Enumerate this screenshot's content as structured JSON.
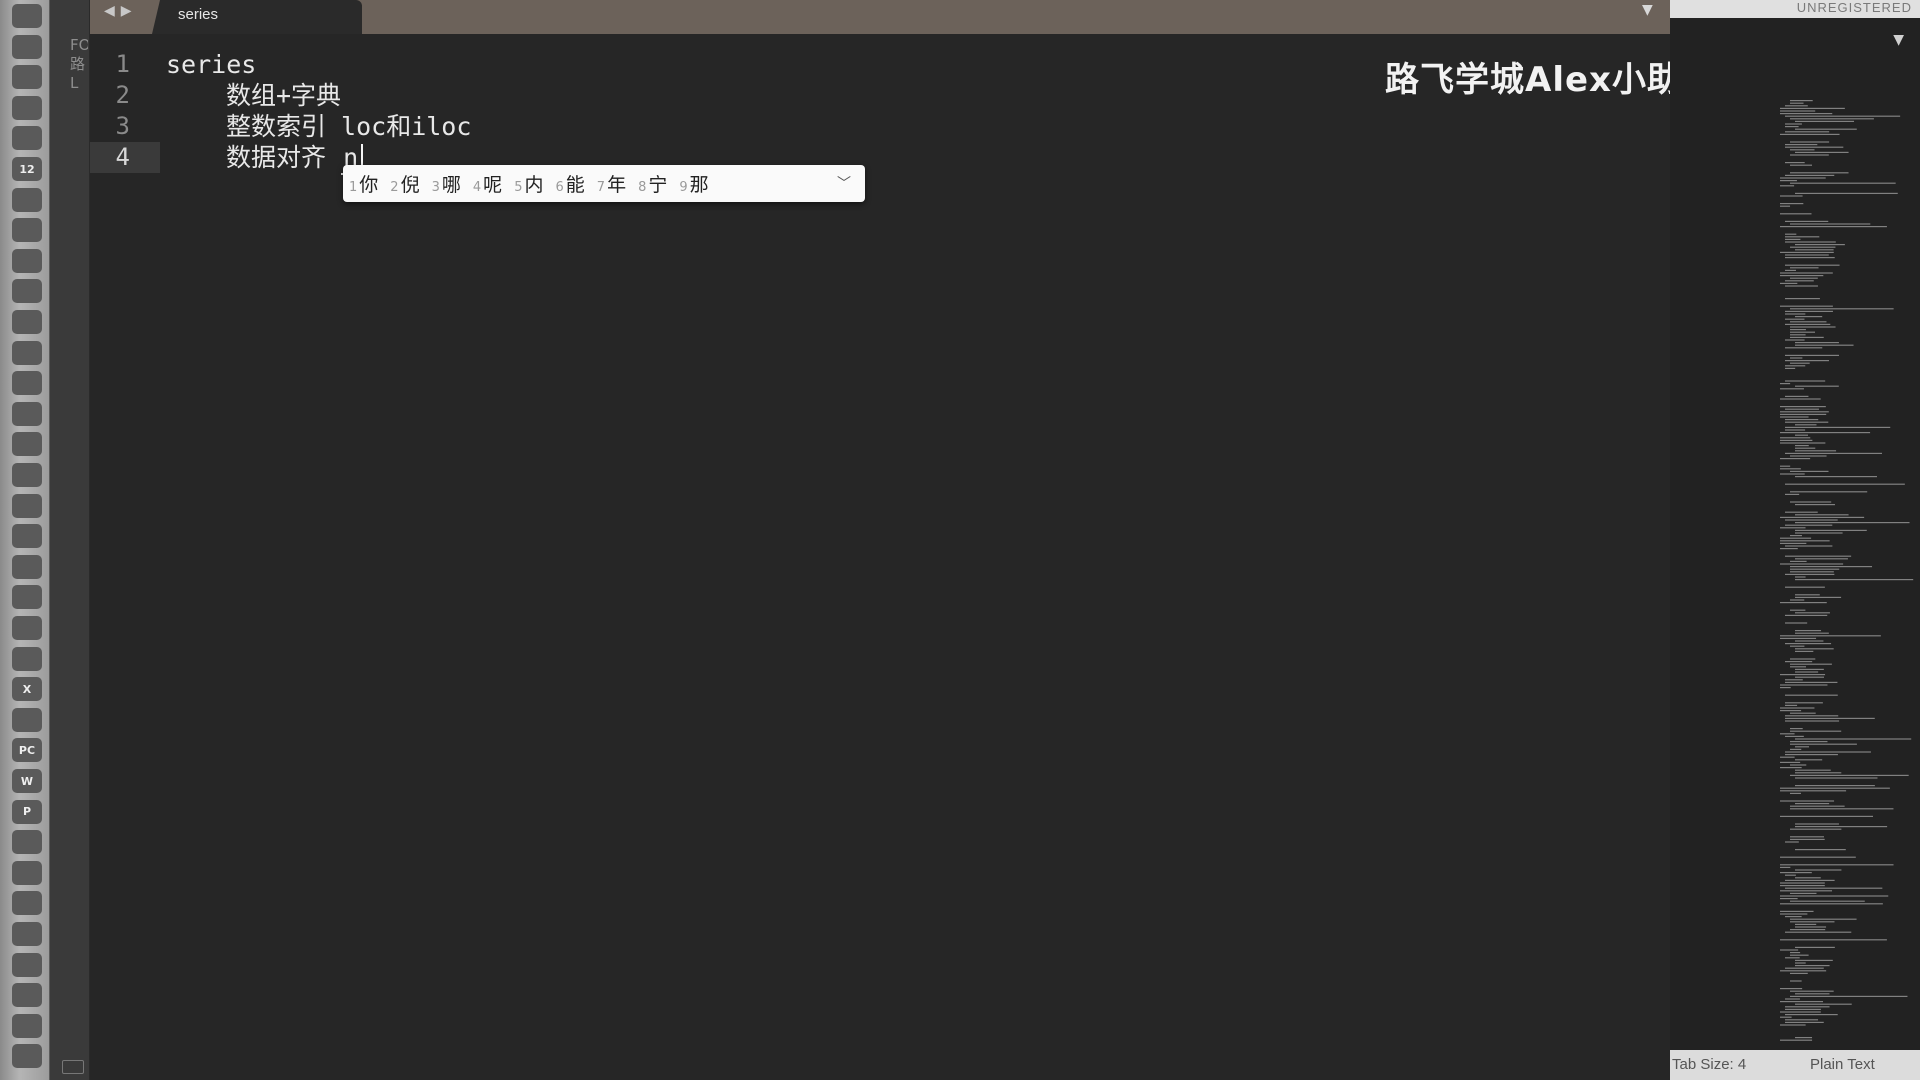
{
  "tab": {
    "title": "series"
  },
  "sidebar": {
    "label": "FO 路 L"
  },
  "editor": {
    "line_numbers": [
      "1",
      "2",
      "3",
      "4"
    ],
    "lines": [
      "series",
      "数组+字典",
      "整数索引 loc和iloc",
      "数据对齐 "
    ],
    "composing_text": "n"
  },
  "ime": {
    "candidates": [
      {
        "num": "1",
        "char": "你"
      },
      {
        "num": "2",
        "char": "倪"
      },
      {
        "num": "3",
        "char": "哪"
      },
      {
        "num": "4",
        "char": "呢"
      },
      {
        "num": "5",
        "char": "内"
      },
      {
        "num": "6",
        "char": "能"
      },
      {
        "num": "7",
        "char": "年"
      },
      {
        "num": "8",
        "char": "宁"
      },
      {
        "num": "9",
        "char": "那"
      }
    ],
    "expand_icon": "chevron-down-icon"
  },
  "watermark": {
    "text": "路飞学城Alex小助理",
    "logo": "bilibili"
  },
  "minimap": {
    "unregistered": "UNREGISTERED"
  },
  "status": {
    "tab_size": "Tab Size: 4",
    "syntax": "Plain Text"
  },
  "dock": {
    "items": [
      "",
      "",
      "",
      "",
      "",
      "12",
      "",
      "",
      "",
      "",
      "",
      "",
      "",
      "",
      "",
      "",
      "",
      "",
      "",
      "",
      "",
      "",
      "X",
      "",
      "PC",
      "W",
      "P",
      "",
      "",
      "",
      "",
      "",
      "",
      "",
      ""
    ]
  },
  "colors": {
    "editor_bg": "#262626",
    "tabbar_bg": "#6c625a",
    "text": "#e8e8e8"
  }
}
